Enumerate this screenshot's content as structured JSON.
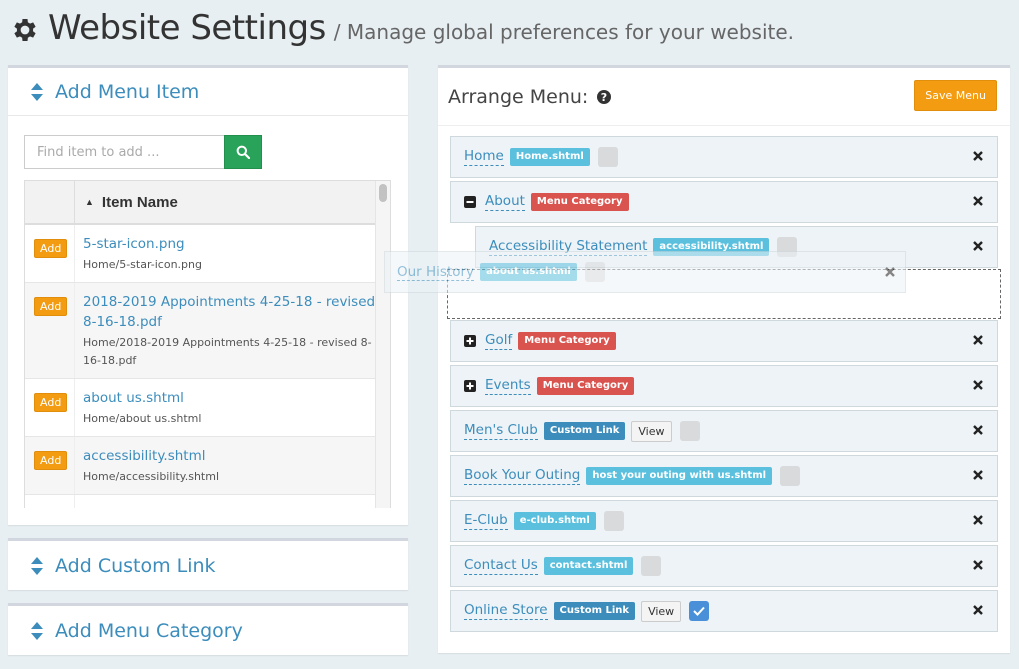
{
  "header": {
    "title": "Website Settings",
    "subtitle": "/ Manage global preferences for your website."
  },
  "add_item": {
    "title": "Add Menu Item",
    "search_placeholder": "Find item to add ...",
    "column_header": "Item Name",
    "add_label": "Add",
    "rows": [
      {
        "name": "5-star-icon.png",
        "path": "Home/5-star-icon.png"
      },
      {
        "name": "2018-2019 Appointments 4-25-18 - revised 8-16-18.pdf",
        "path": "Home/2018-2019 Appointments 4-25-18 - revised 8-16-18.pdf"
      },
      {
        "name": "about us.shtml",
        "path": "Home/about us.shtml"
      },
      {
        "name": "accessibility.shtml",
        "path": "Home/accessibility.shtml"
      },
      {
        "name": "",
        "path": ""
      }
    ]
  },
  "custom_link_panel": {
    "title": "Add Custom Link"
  },
  "category_panel": {
    "title": "Add Menu Category"
  },
  "arrange": {
    "title": "Arrange Menu:",
    "save_label": "Save Menu",
    "view_label": "View",
    "items": [
      {
        "label": "Home",
        "badge": "Home.shtml",
        "badge_type": "file",
        "checked": false
      },
      {
        "label": "About",
        "badge": "Menu Category",
        "badge_type": "category",
        "expanded": true
      },
      {
        "label": "Accessibility Statement",
        "badge": "accessibility.shtml",
        "badge_type": "file",
        "checked": false,
        "child": true
      },
      {
        "label": "Golf",
        "badge": "Menu Category",
        "badge_type": "category",
        "expanded": false
      },
      {
        "label": "Events",
        "badge": "Menu Category",
        "badge_type": "category",
        "expanded": false
      },
      {
        "label": "Men's Club",
        "badge": "Custom Link",
        "badge_type": "link",
        "checked": false
      },
      {
        "label": "Book Your Outing",
        "badge": "host your outing with us.shtml",
        "badge_type": "file",
        "checked": false
      },
      {
        "label": "E-Club",
        "badge": "e-club.shtml",
        "badge_type": "file",
        "checked": false
      },
      {
        "label": "Contact Us",
        "badge": "contact.shtml",
        "badge_type": "file",
        "checked": false
      },
      {
        "label": "Online Store",
        "badge": "Custom Link",
        "badge_type": "link",
        "checked": true
      }
    ],
    "dragging": {
      "label": "Our History",
      "badge": "about us.shtml",
      "badge_type": "file"
    }
  },
  "colors": {
    "accent": "#3c8dbc",
    "orange": "#f39c12",
    "green": "#29a35a",
    "red": "#d9534f",
    "cyan": "#5bc0de"
  },
  "icons": {
    "header": "gear-icon",
    "search": "search-icon",
    "help": "question-circle-icon",
    "remove": "close-icon",
    "panel_toggle": "sort-caret-icon",
    "expand": "plus-square-icon",
    "collapse": "minus-square-icon"
  }
}
